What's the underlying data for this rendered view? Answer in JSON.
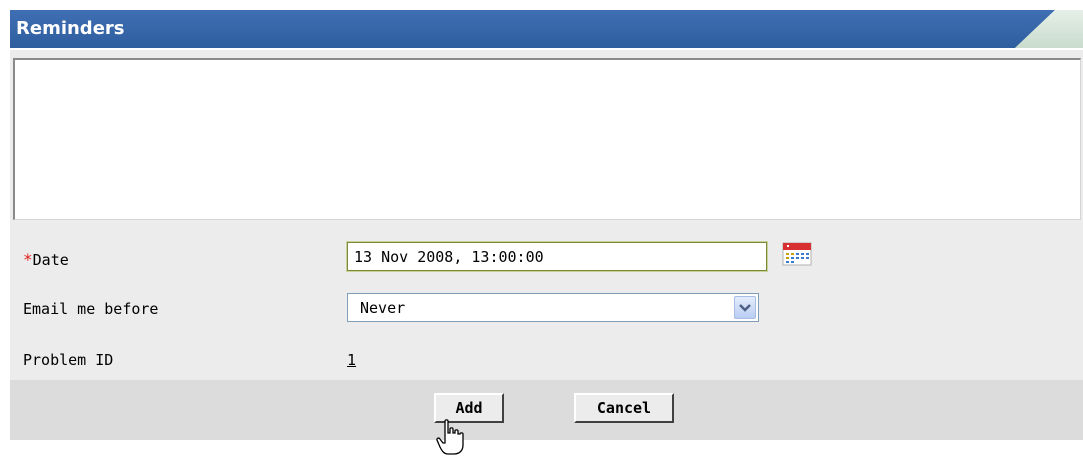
{
  "window": {
    "title": "Reminders"
  },
  "form": {
    "textarea_value": "",
    "date": {
      "required_marker": "*",
      "label": "Date",
      "value": "13 Nov 2008, 13:00:00",
      "calendar_icon": "calendar-icon"
    },
    "email_before": {
      "label": "Email me before",
      "selected": "Never",
      "dropdown_icon": "chevron-down-icon"
    },
    "problem_id": {
      "label": "Problem ID",
      "value": "1"
    }
  },
  "buttons": {
    "add_label": "Add",
    "cancel_label": "Cancel"
  },
  "colors": {
    "header_blue": "#3366aa",
    "required_red": "#e02020",
    "panel_bg": "#ececec",
    "button_bar_bg": "#dcdcdc"
  }
}
